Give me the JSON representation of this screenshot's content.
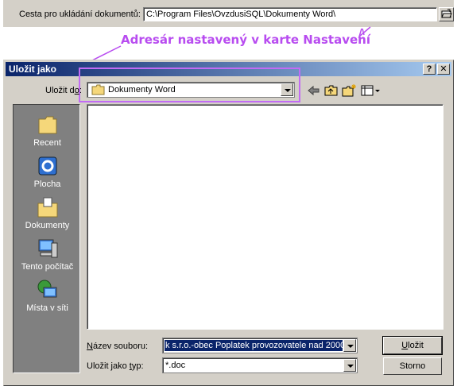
{
  "top": {
    "path_label": "Cesta pro ukládání dokumentů:",
    "path_value": "C:\\Program Files\\OvzdusiSQL\\Dokumenty Word\\"
  },
  "annotation": {
    "text": "Adresár nastavený v karte Nastavení",
    "color": "#b84cf0"
  },
  "dialog": {
    "title": "Uložit jako",
    "help_button": "?",
    "close_button": "✕",
    "lookin_label": {
      "pre": "Uložit d",
      "accel": "o",
      "post": ":"
    },
    "lookin_value": "Dokumenty Word",
    "toolbar_icons": [
      "back-arrow-icon",
      "up-folder-icon",
      "new-folder-icon",
      "view-menu-icon"
    ],
    "places": [
      {
        "label": "Recent",
        "icon": "recent-icon"
      },
      {
        "label": "Plocha",
        "icon": "desktop-icon"
      },
      {
        "label": "Dokumenty",
        "icon": "documents-icon"
      },
      {
        "label": "Tento počítač",
        "icon": "computer-icon"
      },
      {
        "label": "Místa v síti",
        "icon": "network-icon"
      }
    ],
    "filename_label": {
      "accel": "N",
      "post": "ázev souboru:"
    },
    "filename_value": "k s.r.o.-obec Poplatek provozovatele nad 2000",
    "filetype_label": {
      "pre": "Uložit jako ",
      "accel": "t",
      "post": "yp:"
    },
    "filetype_value": "*.doc",
    "save_button": {
      "accel": "U",
      "post": "ložit"
    },
    "cancel_button": "Storno"
  }
}
